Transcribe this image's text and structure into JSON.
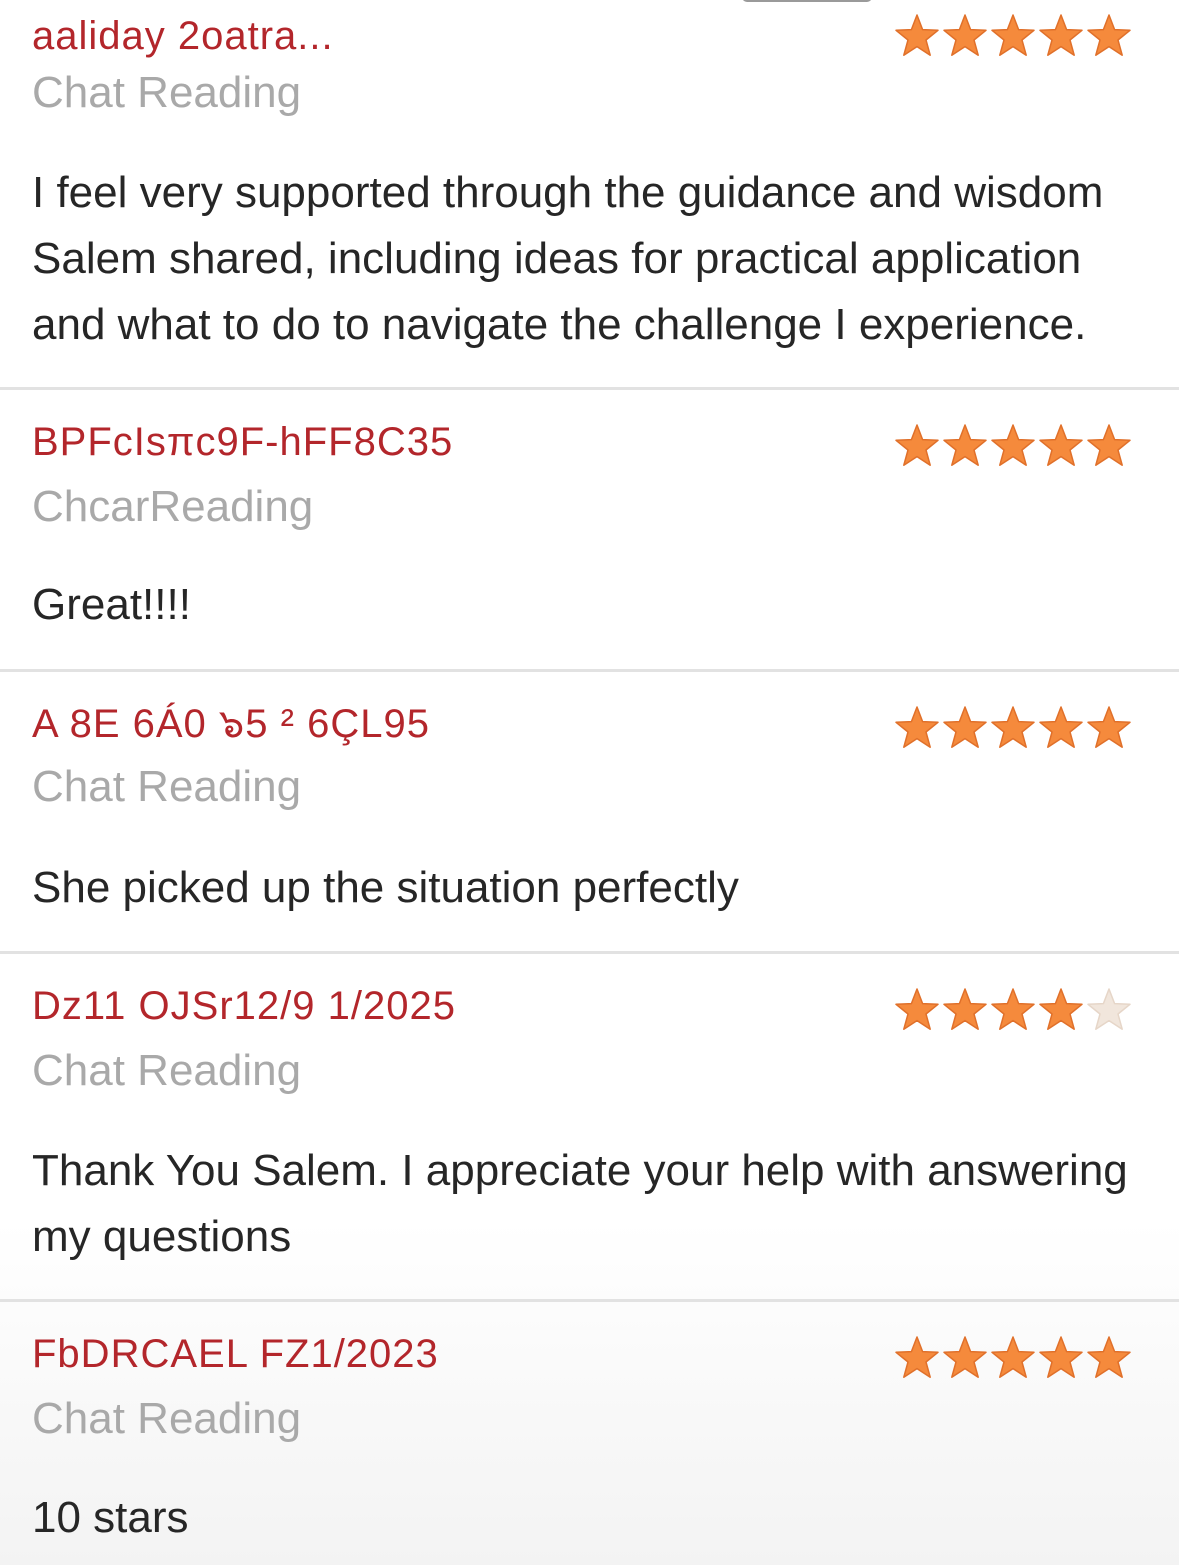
{
  "colors": {
    "reviewer_name": "#b3262b",
    "reading_type": "#a9a9a9",
    "review_text": "#262626",
    "divider": "#e2e2e2",
    "star_filled": "#f58a3c",
    "star_empty": "#f1e6dc"
  },
  "reviews": [
    {
      "reviewer": "aaliday 2oatra...",
      "reading_type": "Chat Reading",
      "rating": 5,
      "text": "I feel very supported through the guidance and wisdom Salem shared, including ideas for practical application and what to do to navigate the challenge I experience."
    },
    {
      "reviewer": "BPFcIsπc9F-hFF8C35",
      "reading_type": "ChcarReading",
      "rating": 5,
      "text": "Great!!!!"
    },
    {
      "reviewer": "A 8E 6Á0 ๖5 ² 6ÇL95",
      "reading_type": "Chat Reading",
      "rating": 5,
      "text": "She picked up the situation perfectly"
    },
    {
      "reviewer": "Dz11 OJSr12/9 1/2025",
      "reading_type": "Chat Reading",
      "rating": 4,
      "text": "Thank You Salem. I appreciate your help with answering my questions"
    },
    {
      "reviewer": "FbDRCAEL FZ1/2023",
      "reading_type": "Chat Reading",
      "rating": 5,
      "text": "10 stars"
    }
  ]
}
